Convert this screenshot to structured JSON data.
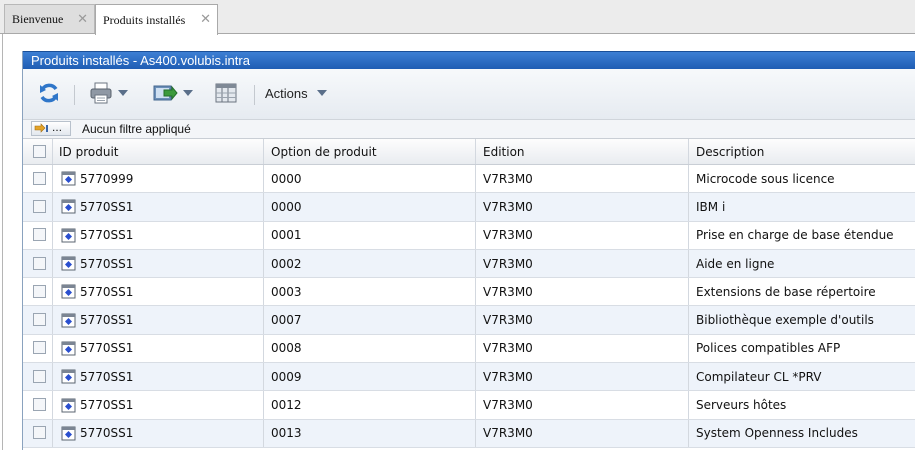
{
  "tabs": [
    {
      "label": "Bienvenue"
    },
    {
      "label": "Produits installés"
    }
  ],
  "panel": {
    "title": "Produits installés - As400.volubis.intra"
  },
  "toolbar": {
    "refresh_icon": "refresh-icon",
    "print_icon": "printer-icon",
    "export_icon": "export-icon",
    "columns_icon": "table-columns-icon",
    "actions_label": "Actions"
  },
  "filter": {
    "button_label": "…",
    "status": "Aucun filtre appliqué"
  },
  "table": {
    "columns": [
      "ID produit",
      "Option de produit",
      "Edition",
      "Description"
    ],
    "rows": [
      {
        "id": "5770999",
        "option": "0000",
        "edition": "V7R3M0",
        "description": "Microcode sous licence"
      },
      {
        "id": "5770SS1",
        "option": "0000",
        "edition": "V7R3M0",
        "description": "IBM i"
      },
      {
        "id": "5770SS1",
        "option": "0001",
        "edition": "V7R3M0",
        "description": "Prise en charge de base étendue"
      },
      {
        "id": "5770SS1",
        "option": "0002",
        "edition": "V7R3M0",
        "description": "Aide en ligne"
      },
      {
        "id": "5770SS1",
        "option": "0003",
        "edition": "V7R3M0",
        "description": "Extensions de base répertoire"
      },
      {
        "id": "5770SS1",
        "option": "0007",
        "edition": "V7R3M0",
        "description": "Bibliothèque exemple d'outils"
      },
      {
        "id": "5770SS1",
        "option": "0008",
        "edition": "V7R3M0",
        "description": "Polices compatibles AFP"
      },
      {
        "id": "5770SS1",
        "option": "0009",
        "edition": "V7R3M0",
        "description": "Compilateur CL *PRV"
      },
      {
        "id": "5770SS1",
        "option": "0012",
        "edition": "V7R3M0",
        "description": "Serveurs hôtes"
      },
      {
        "id": "5770SS1",
        "option": "0013",
        "edition": "V7R3M0",
        "description": "System Openness Includes"
      }
    ]
  },
  "colors": {
    "title_bar": "#2b6cc4",
    "row_alt": "#eef3fa"
  }
}
